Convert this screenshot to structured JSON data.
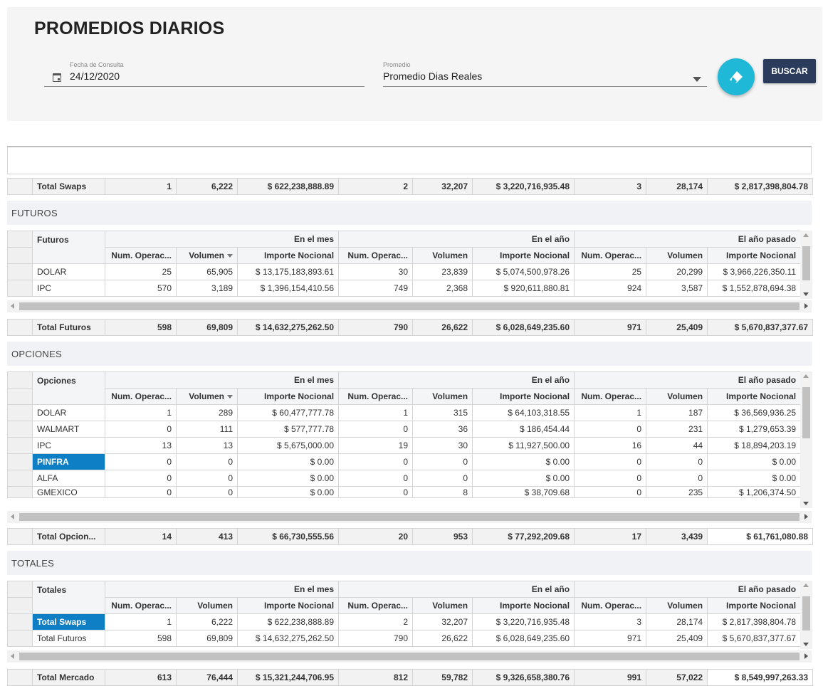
{
  "header": {
    "title": "PROMEDIOS DIARIOS",
    "fecha_label": "Fecha de Consulta",
    "fecha_value": "24/12/2020",
    "promedio_label": "Promedio",
    "promedio_value": "Promedio Dias Reales",
    "buscar_label": "BUSCAR",
    "clear_icon": "eraser-icon",
    "accent_color": "#1fb8d6",
    "buscar_color": "#2b3b5c"
  },
  "groups": {
    "mes": "En el mes",
    "anio": "En el año",
    "anio_pasado": "El año pasado"
  },
  "cols": {
    "num_ops": "Num. Operac...",
    "volumen": "Volumen",
    "importe": "Importe Nocional"
  },
  "total_swaps": {
    "label": "Total Swaps",
    "values": [
      "1",
      "6,222",
      "$ 622,238,888.89",
      "2",
      "32,207",
      "$ 3,220,716,935.48",
      "3",
      "28,174",
      "$ 2,817,398,804.78"
    ]
  },
  "futuros": {
    "section_title": "FUTUROS",
    "header_label": "Futuros",
    "rows": [
      {
        "label": "DOLAR",
        "values": [
          "25",
          "65,905",
          "$ 13,175,183,893.61",
          "30",
          "23,839",
          "$ 5,074,500,978.26",
          "25",
          "20,299",
          "$ 3,966,226,350.11"
        ]
      },
      {
        "label": "IPC",
        "values": [
          "570",
          "3,189",
          "$ 1,396,154,410.56",
          "749",
          "2,368",
          "$ 920,611,880.81",
          "924",
          "3,587",
          "$ 1,552,878,694.38"
        ]
      }
    ],
    "total": {
      "label": "Total Futuros",
      "values": [
        "598",
        "69,809",
        "$ 14,632,275,262.50",
        "790",
        "26,622",
        "$ 6,028,649,235.60",
        "971",
        "25,409",
        "$ 5,670,837,377.67"
      ]
    }
  },
  "opciones": {
    "section_title": "OPCIONES",
    "header_label": "Opciones",
    "rows": [
      {
        "label": "DOLAR",
        "values": [
          "1",
          "289",
          "$ 60,477,777.78",
          "1",
          "315",
          "$ 64,103,318.55",
          "1",
          "187",
          "$ 36,569,936.25"
        ]
      },
      {
        "label": "WALMART",
        "values": [
          "0",
          "111",
          "$ 577,777.78",
          "0",
          "36",
          "$ 186,454.44",
          "0",
          "231",
          "$ 1,279,653.39"
        ]
      },
      {
        "label": "IPC",
        "values": [
          "13",
          "13",
          "$ 5,675,000.00",
          "19",
          "30",
          "$ 11,927,500.00",
          "16",
          "44",
          "$ 18,894,203.19"
        ]
      },
      {
        "label": "PINFRA",
        "values": [
          "0",
          "0",
          "$ 0.00",
          "0",
          "0",
          "$ 0.00",
          "0",
          "0",
          "$ 0.00"
        ]
      },
      {
        "label": "ALFA",
        "values": [
          "0",
          "0",
          "$ 0.00",
          "0",
          "0",
          "$ 0.00",
          "0",
          "0",
          "$ 0.00"
        ]
      },
      {
        "label": "GMEXICO",
        "values": [
          "0",
          "0",
          "$ 0.00",
          "0",
          "8",
          "$ 38,709.68",
          "0",
          "235",
          "$ 1,206,374.50"
        ]
      }
    ],
    "total": {
      "label": "Total Opcion...",
      "values": [
        "14",
        "413",
        "$ 66,730,555.56",
        "20",
        "953",
        "$ 77,292,209.68",
        "17",
        "3,439",
        "$ 61,761,080.88"
      ]
    }
  },
  "totales": {
    "section_title": "TOTALES",
    "header_label": "Totales",
    "rows": [
      {
        "label": "Total Swaps",
        "values": [
          "1",
          "6,222",
          "$ 622,238,888.89",
          "2",
          "32,207",
          "$ 3,220,716,935.48",
          "3",
          "28,174",
          "$ 2,817,398,804.78"
        ]
      },
      {
        "label": "Total Futuros",
        "values": [
          "598",
          "69,809",
          "$ 14,632,275,262.50",
          "790",
          "26,622",
          "$ 6,028,649,235.60",
          "971",
          "25,409",
          "$ 5,670,837,377.67"
        ]
      }
    ],
    "total": {
      "label": "Total Mercado",
      "values": [
        "613",
        "76,444",
        "$ 15,321,244,706.95",
        "812",
        "59,782",
        "$ 9,326,658,380.76",
        "991",
        "57,022",
        "$ 8,549,997,263.33"
      ]
    }
  }
}
